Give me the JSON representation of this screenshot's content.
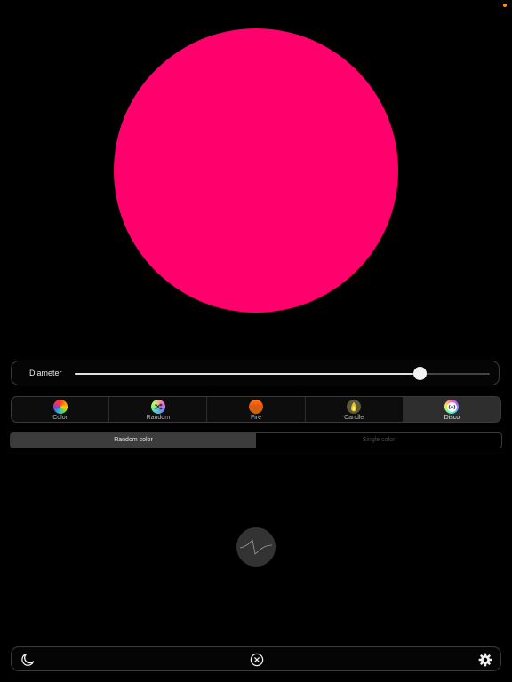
{
  "colors": {
    "light": "#ff006c",
    "status_dot": "#ff9500",
    "slider_fill": "#e0e0e0"
  },
  "diameter": {
    "label": "Diameter",
    "value": 0.83
  },
  "modes": [
    {
      "label": "Color",
      "icon": "color-wheel-icon",
      "selected": false
    },
    {
      "label": "Random",
      "icon": "shuffle-icon",
      "selected": false
    },
    {
      "label": "Fire",
      "icon": "fire-icon",
      "selected": false
    },
    {
      "label": "Candle",
      "icon": "candle-flame-icon",
      "selected": false
    },
    {
      "label": "Disco",
      "icon": "disco-icon",
      "selected": true
    }
  ],
  "color_mode": {
    "options": [
      "Random color",
      "Single color"
    ],
    "selected_index": 0
  },
  "flicker": {
    "icon": "waveform-icon"
  },
  "toolbar": {
    "left_icon": "moon-icon",
    "center_icon": "close-circle-icon",
    "right_icon": "gear-icon"
  }
}
